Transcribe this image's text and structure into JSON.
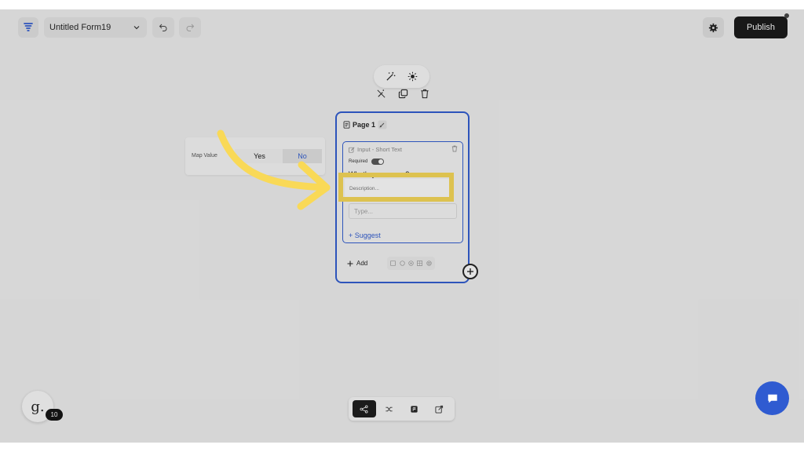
{
  "header": {
    "form_title": "Untitled Form19",
    "publish_label": "Publish"
  },
  "page": {
    "title": "Page 1",
    "field": {
      "type_label": "Input - Short Text",
      "required_label": "Required",
      "question": "What's your name?",
      "description_placeholder": "Description...",
      "answer_placeholder": "Type...",
      "suggest_label": "+ Suggest"
    },
    "add_label": "Add"
  },
  "map_value": {
    "label": "Map Value",
    "yes": "Yes",
    "no": "No"
  },
  "workspace": {
    "avatar_letter": "g.",
    "badge_count": "10"
  },
  "colors": {
    "accent": "#2f5bd1",
    "highlight": "#f9d957",
    "primary_button": "#161616"
  },
  "icons": [
    "logo-icon",
    "chevron-down-icon",
    "undo-icon",
    "redo-icon",
    "gear-icon",
    "magic-wand-icon",
    "sun-icon",
    "wand-off-icon",
    "copy-icon",
    "trash-icon",
    "page-icon",
    "pencil-icon",
    "edit-icon",
    "plus-icon",
    "share-icon",
    "shuffle-icon",
    "flag-icon",
    "chat-icon"
  ]
}
